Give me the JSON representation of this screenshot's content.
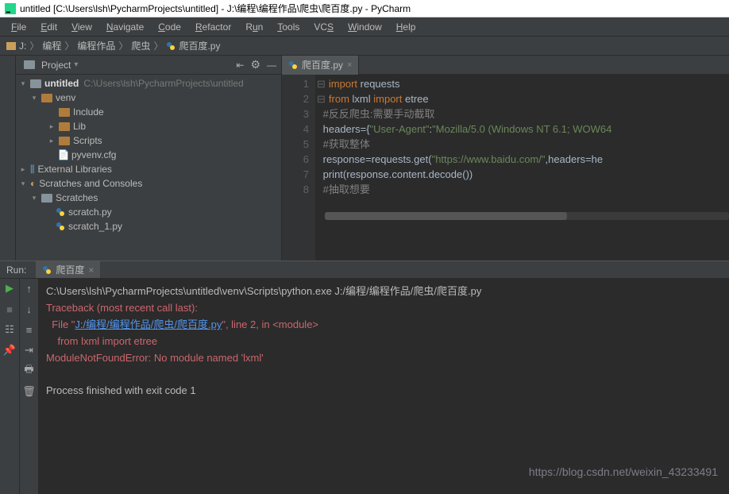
{
  "title": "untitled [C:\\Users\\lsh\\PycharmProjects\\untitled] - J:\\编程\\编程作品\\爬虫\\爬百度.py - PyCharm",
  "menu": [
    "File",
    "Edit",
    "View",
    "Navigate",
    "Code",
    "Refactor",
    "Run",
    "Tools",
    "VCS",
    "Window",
    "Help"
  ],
  "breadcrumb": {
    "drive": "J:",
    "parts": [
      "编程",
      "编程作品",
      "爬虫"
    ],
    "file": "爬百度.py"
  },
  "sidebar": {
    "title": "Project",
    "root": {
      "name": "untitled",
      "path": "C:\\Users\\lsh\\PycharmProjects\\untitled"
    },
    "venv": "venv",
    "venv_children": [
      "Include",
      "Lib",
      "Scripts"
    ],
    "pyvenv": "pyvenv.cfg",
    "external": "External Libraries",
    "scratches_root": "Scratches and Consoles",
    "scratches": "Scratches",
    "scratch_files": [
      "scratch.py",
      "scratch_1.py"
    ]
  },
  "editor": {
    "tab": "爬百度.py",
    "lines": {
      "l1_a": "import",
      "l1_b": " requests",
      "l2_a": "from",
      "l2_b": " lxml ",
      "l2_c": "import",
      "l2_d": " etree",
      "l3": "#反反爬虫:需要手动截取",
      "l4_a": "headers={",
      "l4_b": "\"User-Agent\"",
      "l4_c": ":",
      "l4_d": "\"Mozilla/5.0 (Windows NT 6.1; WOW64",
      "l5": "#获取整体",
      "l6_a": "response=requests.get(",
      "l6_b": "\"https://www.baidu.com/\"",
      "l6_c": ",headers=he",
      "l7": "print(response.content.decode())",
      "l8": "#抽取想要"
    },
    "line_count": 8
  },
  "run": {
    "label": "Run:",
    "tab": "爬百度",
    "cmd": "C:\\Users\\lsh\\PycharmProjects\\untitled\\venv\\Scripts\\python.exe J:/编程/编程作品/爬虫/爬百度.py",
    "trace": "Traceback (most recent call last):",
    "file_prefix": "  File \"",
    "file_link": "J:/编程/编程作品/爬虫/爬百度.py",
    "file_suffix": "\", line 2, in <module>",
    "from_line": "    from lxml import etree",
    "error": "ModuleNotFoundError: No module named 'lxml'",
    "exit": "Process finished with exit code 1"
  },
  "watermark": "https://blog.csdn.net/weixin_43233491"
}
